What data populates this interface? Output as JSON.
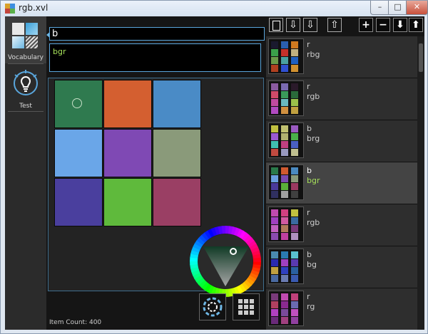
{
  "window": {
    "title": "rgb.xvl"
  },
  "colors": {
    "accent": "#5aa6dc",
    "tag_green": "#a6e05a"
  },
  "nav": [
    {
      "label": "Vocabulary",
      "icon": "vocabulary-icon",
      "active": true
    },
    {
      "label": "Test",
      "icon": "lightbulb-icon",
      "active": false
    }
  ],
  "search": {
    "value": "b"
  },
  "tags": {
    "value": "bgr"
  },
  "grid": {
    "cells": [
      {
        "color": "#2f7a4f",
        "selected": true
      },
      {
        "color": "#d45f30"
      },
      {
        "color": "#4a8bc6"
      },
      {
        "color": "#6aa6e8"
      },
      {
        "color": "#7f49b4"
      },
      {
        "color": "#8a9a7a"
      },
      {
        "color": "#4a3f9e"
      },
      {
        "color": "#5fba3c"
      },
      {
        "color": "#9a3f64"
      }
    ]
  },
  "status": {
    "item_count": "Item Count: 400"
  },
  "toolbar": [
    {
      "name": "new-file-button",
      "glyph": "🗋"
    },
    {
      "name": "import-button",
      "glyph": "⇩"
    },
    {
      "name": "import-add-button",
      "glyph": "⇩"
    },
    {
      "name": "export-button",
      "glyph": "⇧"
    },
    {
      "name": "add-button",
      "glyph": "+"
    },
    {
      "name": "remove-button",
      "glyph": "−"
    },
    {
      "name": "move-down-button",
      "glyph": "⬇"
    },
    {
      "name": "move-up-button",
      "glyph": "⬆"
    }
  ],
  "list": [
    {
      "name": "r",
      "tags": "rbg",
      "colors": [
        "#1a1a2e",
        "#2a5fb0",
        "#d07a20",
        "#3aa04a",
        "#c4302a",
        "#c0b080",
        "#6a9a4a",
        "#4aa0a0",
        "#2060c0",
        "#b04020",
        "#3050d0",
        "#d09030"
      ]
    },
    {
      "name": "r",
      "tags": "rgb",
      "colors": [
        "#8a5aa0",
        "#7a6ab0",
        "#2a1a2a",
        "#d04a6a",
        "#3a9a5a",
        "#2a6a3a",
        "#c04aa0",
        "#6abac0",
        "#9ac04a",
        "#b04ac0",
        "#d09040",
        "#c0a040"
      ]
    },
    {
      "name": "b",
      "tags": "brg",
      "colors": [
        "#c0c040",
        "#c0c070",
        "#9a5ac0",
        "#9a5ad0",
        "#b0b070",
        "#4ab04a",
        "#40c0b0",
        "#c04080",
        "#4a60c0",
        "#c04a40",
        "#9a9ac0",
        "#c0c090"
      ]
    },
    {
      "name": "b",
      "tags": "bgr",
      "active": true,
      "colors": [
        "#2a7a4a",
        "#d05a30",
        "#4a8ac0",
        "#6aa0e0",
        "#7a4ab0",
        "#8a9a7a",
        "#4a3a9a",
        "#5ab03a",
        "#9a3a60",
        "#303060",
        "#a0a0a0",
        "#404040"
      ]
    },
    {
      "name": "r",
      "tags": "rgb",
      "colors": [
        "#c04ab0",
        "#d04080",
        "#c0c040",
        "#a040c0",
        "#d05aa0",
        "#3a6aa0",
        "#c060c0",
        "#b07a5a",
        "#7a3a7a",
        "#8a4ab0",
        "#c040a0",
        "#b090c0"
      ]
    },
    {
      "name": "b",
      "tags": "bg",
      "colors": [
        "#4a8ab0",
        "#2a7ab0",
        "#5ac0d0",
        "#2a2ab0",
        "#a040c0",
        "#5a3ab0",
        "#c0a040",
        "#3040c0",
        "#2a60a0",
        "#4a6aa0",
        "#6a7ab0",
        "#3a5ab0"
      ]
    },
    {
      "name": "r",
      "tags": "rg",
      "colors": [
        "#7a3a7a",
        "#c04ab0",
        "#c0407a",
        "#b04060",
        "#8a2a90",
        "#6a6ab0",
        "#b040c0",
        "#7a4a9a",
        "#c050c0",
        "#6a2a7a",
        "#a04080",
        "#9040a0"
      ]
    }
  ]
}
